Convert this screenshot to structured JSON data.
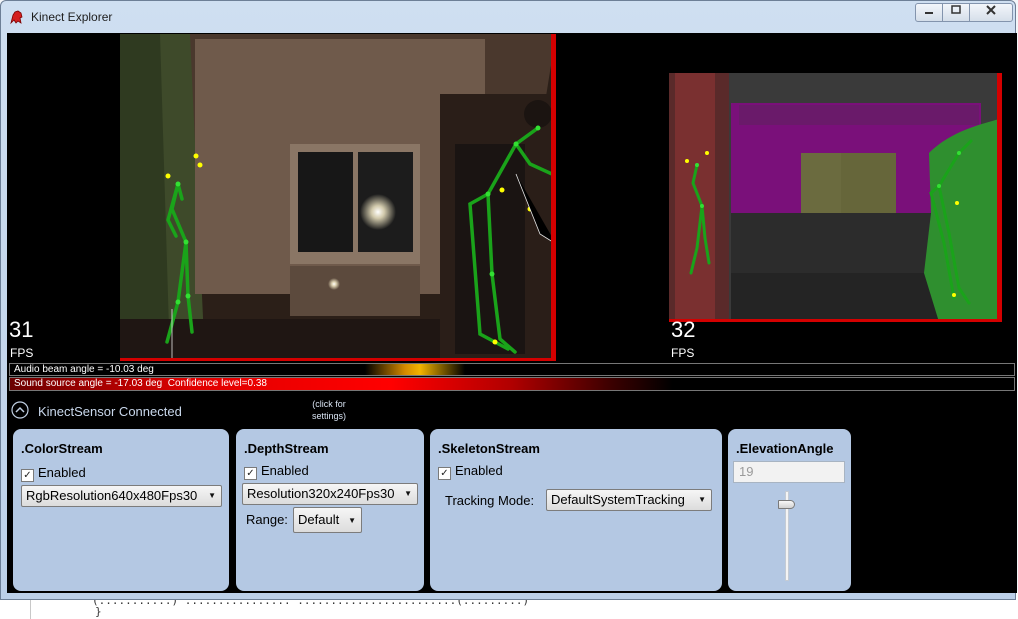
{
  "window": {
    "title": "Kinect Explorer",
    "icon": "kinect-app-icon"
  },
  "controls": {
    "minimize": "minimize-icon",
    "maximize": "maximize-icon",
    "close": "close-icon"
  },
  "color_view": {
    "fps_value": "31",
    "fps_label": "FPS"
  },
  "depth_view": {
    "fps_value": "32",
    "fps_label": "FPS"
  },
  "audio": {
    "beam_text": "Audio beam angle = -10.03 deg",
    "source_text": "Sound source angle = -17.03 deg  Confidence level=0.38"
  },
  "sensor": {
    "status": "KinectSensor Connected",
    "hint": "(click for settings)"
  },
  "color_stream": {
    "title": ".ColorStream",
    "enabled_label": "Enabled",
    "enabled": true,
    "format": "RgbResolution640x480Fps30"
  },
  "depth_stream": {
    "title": ".DepthStream",
    "enabled_label": "Enabled",
    "enabled": true,
    "format": "Resolution320x240Fps30",
    "range_label": "Range:",
    "range_value": "Default"
  },
  "skeleton_stream": {
    "title": ".SkeletonStream",
    "enabled_label": "Enabled",
    "enabled": true,
    "tracking_label": "Tracking Mode:",
    "tracking_value": "DefaultSystemTracking"
  },
  "elevation": {
    "title": ".ElevationAngle",
    "value": "19"
  },
  "colors": {
    "frame_red": "#d40000",
    "panel_bg": "#b4c8e3",
    "skeleton_green": "#1aa31a",
    "joint_yellow": "#ffff00"
  },
  "background_code": {
    "line1": "(...........)  ................  ........................(.........)",
    "line2": "}"
  }
}
